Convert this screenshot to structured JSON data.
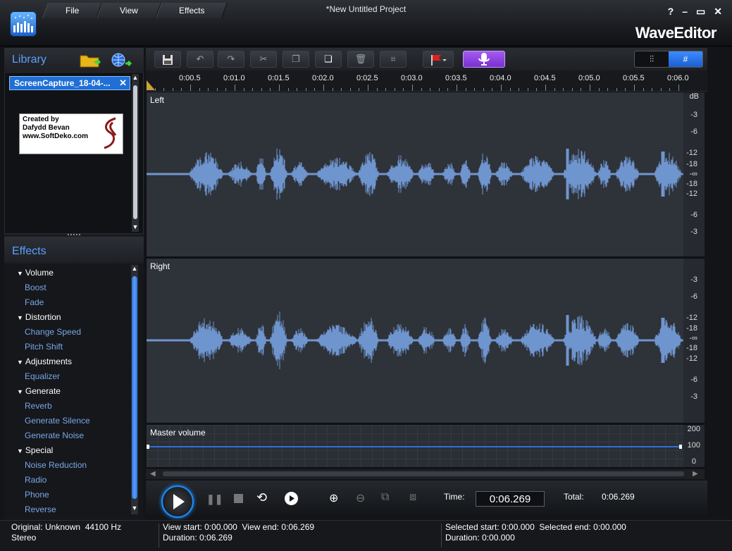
{
  "window": {
    "title": "*New Untitled Project",
    "brand": "WaveEditor",
    "controls": [
      "?",
      "–",
      "▭",
      "✕"
    ]
  },
  "menu": [
    {
      "label": "File"
    },
    {
      "label": "View"
    },
    {
      "label": "Effects"
    }
  ],
  "library": {
    "title": "Library",
    "clip_name": "ScreenCapture_18-04-...",
    "clip_close": "✕",
    "thumbnail_lines": [
      "Created by",
      "Dafydd Bevan",
      "www.SoftDeko.com"
    ]
  },
  "effects": {
    "title": "Effects",
    "groups": [
      {
        "label": "Volume",
        "items": [
          "Boost",
          "Fade"
        ]
      },
      {
        "label": "Distortion",
        "items": [
          "Change Speed",
          "Pitch Shift"
        ]
      },
      {
        "label": "Adjustments",
        "items": [
          "Equalizer"
        ]
      },
      {
        "label": "Generate",
        "items": [
          "Reverb",
          "Generate Silence",
          "Generate Noise"
        ]
      },
      {
        "label": "Special",
        "items": [
          "Noise Reduction",
          "Radio",
          "Phone",
          "Reverse"
        ]
      }
    ]
  },
  "ruler_ticks": [
    "0:00.5",
    "0:01.0",
    "0:01.5",
    "0:02.0",
    "0:02.5",
    "0:03.0",
    "0:03.5",
    "0:04.0",
    "0:04.5",
    "0:05.0",
    "0:05.5",
    "0:06.0"
  ],
  "channels": {
    "left": {
      "label": "Left",
      "db_unit": "dB",
      "db_labels": [
        "-3",
        "-6",
        "-12",
        "-18",
        "-∞",
        "-18",
        "-12",
        "-6",
        "-3"
      ]
    },
    "right": {
      "label": "Right",
      "db_labels": [
        "-3",
        "-6",
        "-12",
        "-18",
        "-∞",
        "-18",
        "-12",
        "-6",
        "-3"
      ]
    }
  },
  "master": {
    "label": "Master volume",
    "scale": [
      "200",
      "100",
      "0"
    ]
  },
  "transport": {
    "time_label": "Time:",
    "time_value": "0:06.269",
    "total_label": "Total:",
    "total_value": "0:06.269"
  },
  "status": {
    "original": "Original: Unknown",
    "sample_rate": "44100 Hz",
    "channels": "Stereo",
    "view_start": "View start: 0:00.000",
    "view_end": "View end: 0:06.269",
    "duration": "Duration: 0:06.269",
    "selected_start": "Selected start: 0:00.000",
    "selected_end": "Selected end: 0:00.000",
    "selected_duration": "Duration: 0:00.000"
  },
  "colors": {
    "accent": "#5aa0ff",
    "waveform": "#6f95cf",
    "record_button": "#8b3fd6"
  }
}
